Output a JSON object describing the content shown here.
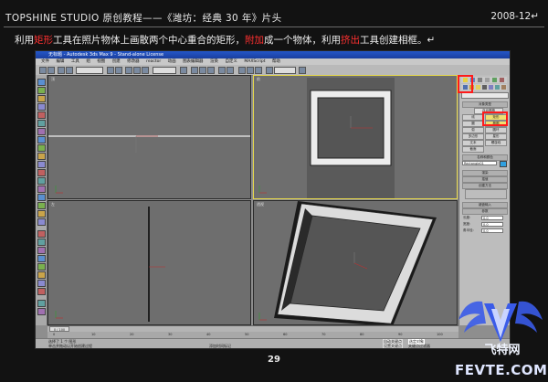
{
  "header": {
    "title": "TOPSHINE STUDIO 原创教程——《潍坊：经典 30 年》片头",
    "date": "2008-12↵"
  },
  "instruction": {
    "part1": "利用",
    "hl1": "矩形",
    "part2": "工具在照片物体上画散两个中心重合的矩形，",
    "hl2": "附加",
    "part3": "成一个物体，利用",
    "hl3": "挤出",
    "part4": "工具创建相框。↵"
  },
  "app": {
    "window_title": "无标题 - Autodesk 3ds Max 9 - Stand-alone License",
    "menu_items": [
      "文件",
      "编辑",
      "工具",
      "组",
      "视图",
      "创建",
      "修改器",
      "reactor",
      "动画",
      "图表编辑器",
      "渲染",
      "自定义",
      "MAXScript",
      "帮助"
    ],
    "viewports": {
      "top_left": "顶",
      "top_right": "前",
      "bottom_left": "左",
      "bottom_right": "透视"
    },
    "command_panel": {
      "rollout_object_type": "对象类型",
      "autogrid": "自动栅格",
      "buttons": [
        "线",
        "矩形",
        "圆",
        "椭圆",
        "弧",
        "圆环",
        "多边形",
        "星形",
        "文本",
        "螺旋线",
        "截面"
      ],
      "rollout_name_color": "名称和颜色",
      "object_name": "Rectangle01",
      "rollout_render": "渲染",
      "rollout_interp": "插值",
      "rollout_creation": "创建方法",
      "rollout_keyboard": "键盘输入",
      "rollout_params": "参数",
      "param_labels": [
        "长度:",
        "宽度:",
        "角半径:"
      ],
      "param_values": [
        "0.0",
        "0.0",
        "0.0"
      ]
    },
    "timeline_label": "0 / 100",
    "ruler_ticks": [
      "0",
      "10",
      "20",
      "30",
      "40",
      "50",
      "60",
      "70",
      "80",
      "90",
      "100"
    ],
    "status": {
      "selection": "选择了 1 个 图形",
      "prompt": "单击并拖动以开始创建过程",
      "add_time_tag": "添加时间标记",
      "autokey": "自动关键点",
      "set_key": "设置关键点",
      "key_filter": "关键点过滤器",
      "selected": "选定对象"
    }
  },
  "page_number": "29",
  "watermark": {
    "cn": "飞特网",
    "en": "FEVTE.COM"
  },
  "colors": {
    "background": "#121212",
    "highlight_red": "#ff3030",
    "active_viewport": "#e6d84a",
    "logo_blue": "#3a5be8"
  }
}
